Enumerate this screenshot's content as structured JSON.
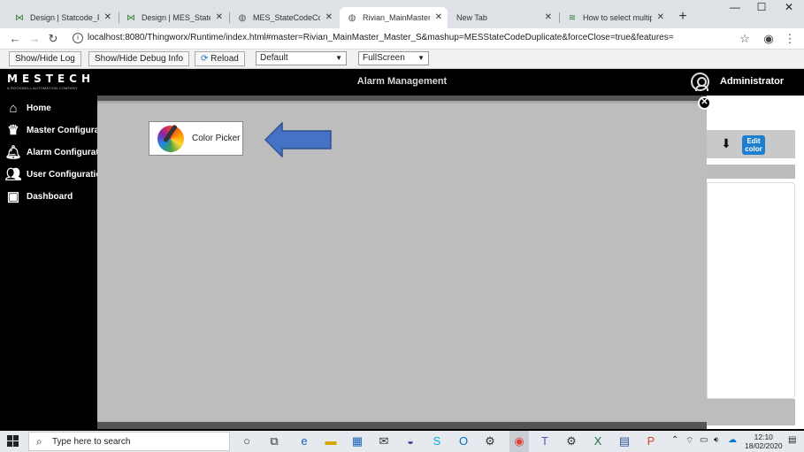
{
  "browser": {
    "tabs": [
      {
        "title": "Design | Statcode_Pric",
        "icon": "thingworx-icon"
      },
      {
        "title": "Design | MES_StateCo",
        "icon": "thingworx-icon"
      },
      {
        "title": "MES_StateCodeColorE",
        "icon": "globe-icon"
      },
      {
        "title": "Rivian_MainMaster_M",
        "icon": "globe-icon"
      },
      {
        "title": "New Tab",
        "icon": ""
      },
      {
        "title": "How to select multiple",
        "icon": "stack-icon"
      }
    ],
    "url": "localhost:8080/Thingworx/Runtime/index.html#master=Rivian_MainMaster_Master_S&mashup=MESStateCodeDuplicate&forceClose=true&features="
  },
  "debug_toolbar": {
    "show_log": "Show/Hide Log",
    "show_debug": "Show/Hide Debug Info",
    "reload": "Reload",
    "theme_select": "Default",
    "mode_select": "FullScreen"
  },
  "app": {
    "logo_text": "MESTECH",
    "logo_sub": "A ROCKWELL AUTOMATION COMPANY",
    "title": "Alarm Management",
    "user": "Administrator",
    "nav": [
      {
        "label": "Home",
        "icon": "home-icon"
      },
      {
        "label": "Master Configurat",
        "icon": "crown-icon"
      },
      {
        "label": "Alarm Configurati",
        "icon": "bell-icon"
      },
      {
        "label": "User Configuratio",
        "icon": "users-icon"
      },
      {
        "label": "Dashboard",
        "icon": "dashboard-icon"
      }
    ],
    "edit_color_label": "Edit color"
  },
  "modal": {
    "color_picker_label": "Color Picker",
    "arrow_color": "#4472c4",
    "overlay_color": "#bdbdbd"
  },
  "taskbar": {
    "search_placeholder": "Type here to search",
    "time": "12:10",
    "date": "18/02/2020"
  }
}
